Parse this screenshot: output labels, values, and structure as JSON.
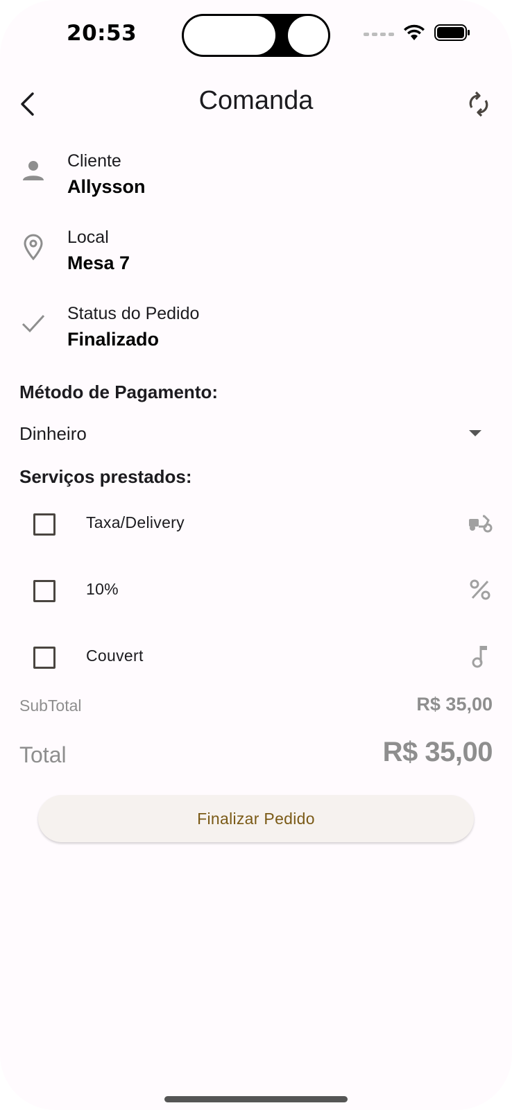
{
  "status_bar": {
    "time": "20:53"
  },
  "header": {
    "title": "Comanda"
  },
  "info": [
    {
      "label": "Cliente",
      "value": "Allysson",
      "icon": "person-icon"
    },
    {
      "label": "Local",
      "value": "Mesa 7",
      "icon": "location-pin-icon"
    },
    {
      "label": "Status do Pedido",
      "value": "Finalizado",
      "icon": "check-icon"
    }
  ],
  "payment": {
    "title": "Método de Pagamento:",
    "selected": "Dinheiro"
  },
  "services": {
    "title": "Serviços prestados:",
    "items": [
      {
        "label": "Taxa/Delivery",
        "checked": false,
        "icon": "delivery-scooter-icon"
      },
      {
        "label": "10%",
        "checked": false,
        "icon": "percent-icon"
      },
      {
        "label": "Couvert",
        "checked": false,
        "icon": "music-note-icon"
      }
    ]
  },
  "totals": {
    "subtotal_label": "SubTotal",
    "subtotal_value": "R$ 35,00",
    "total_label": "Total",
    "total_value": "R$ 35,00"
  },
  "actions": {
    "finalize_label": "Finalizar Pedido"
  },
  "colors": {
    "background": "#fffbfe",
    "button_bg": "#f6f2ef",
    "button_text": "#7a5a16",
    "muted": "#8e8e8e"
  }
}
